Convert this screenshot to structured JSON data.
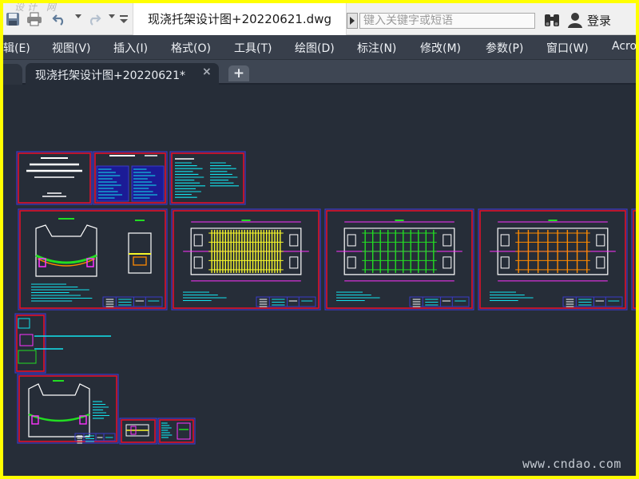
{
  "titlebar": {
    "brand_mark": "设计 网",
    "document_title": "现浇托架设计图+20220621.dwg",
    "search_placeholder": "键入关键字或短语",
    "login_label": "登录",
    "icons": [
      "save-icon",
      "print-icon",
      "undo-icon",
      "redo-icon",
      "customize-caret-icon",
      "binoculars-icon",
      "user-icon"
    ]
  },
  "menu": {
    "items": [
      "辑(E)",
      "视图(V)",
      "插入(I)",
      "格式(O)",
      "工具(T)",
      "绘图(D)",
      "标注(N)",
      "修改(M)",
      "参数(P)",
      "窗口(W)",
      "Acro"
    ]
  },
  "tabs": {
    "active_label": "现浇托架设计图+20220621*",
    "close_icon": "×",
    "new_tab_icon": "+"
  },
  "canvas": {
    "background": "#262d38",
    "frame_color": "#e0102a",
    "sheet_border_color": "#3a3ac8",
    "watermark": "www.cndao.com",
    "sheets": [
      "cover-sheet",
      "index-sheet",
      "notes-sheet",
      "bracket-elevation-sheet",
      "plan-yellow-sheet",
      "plan-green-sheet",
      "plan-orange-sheet",
      "partial-sheet",
      "detail-column-sheet",
      "bracket-elevation-sheet-2",
      "small-detail-sheet-1",
      "small-detail-sheet-2"
    ]
  },
  "colors": {
    "highlight_frame": "#ffff00",
    "menubar": "#383f4b",
    "titlebar": "#f0f0f0",
    "accent_cyan": "#12e4ee",
    "accent_yellow": "#f6f72a",
    "accent_magenta": "#ff33ff",
    "accent_green": "#22dd22",
    "accent_orange": "#ff8a00",
    "accent_white": "#ffffff"
  }
}
